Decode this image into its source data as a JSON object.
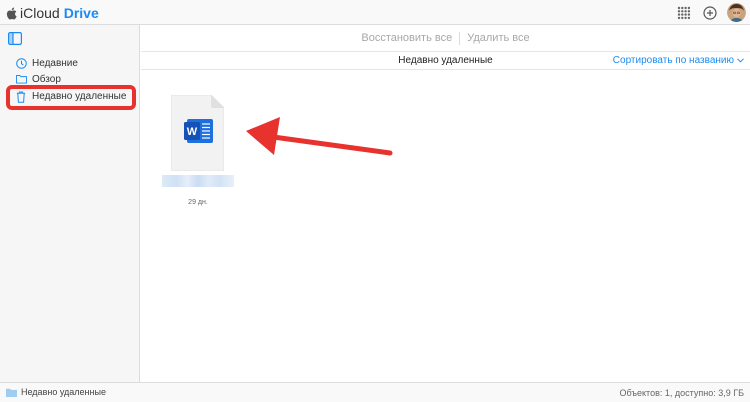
{
  "header": {
    "brand_icloud": "iCloud",
    "brand_drive": "Drive",
    "icons": [
      "apple-icon",
      "app-grid-icon",
      "add-icon",
      "avatar"
    ]
  },
  "sidebar": {
    "toggle_icon": "sidebar-toggle-icon",
    "items": [
      {
        "label": "Недавние",
        "icon": "clock-icon"
      },
      {
        "label": "Обзор",
        "icon": "folder-icon"
      },
      {
        "label": "Недавно удаленные",
        "icon": "trash-icon",
        "selected": true
      }
    ]
  },
  "toolbar": {
    "restore_all": "Восстановить все",
    "delete_all": "Удалить все"
  },
  "main": {
    "section_title": "Недавно удаленные",
    "sort_label": "Сортировать по названию",
    "files": [
      {
        "type": "word-document",
        "badge": "W",
        "name_obscured": true,
        "days_left": "29 дн."
      }
    ]
  },
  "status": {
    "location": "Недавно удаленные",
    "summary": "Объектов: 1, доступно: 3,9 ГБ"
  },
  "colors": {
    "accent": "#1b8bf2",
    "word_blue": "#1e6fe0",
    "annotation_red": "#e8322e"
  }
}
